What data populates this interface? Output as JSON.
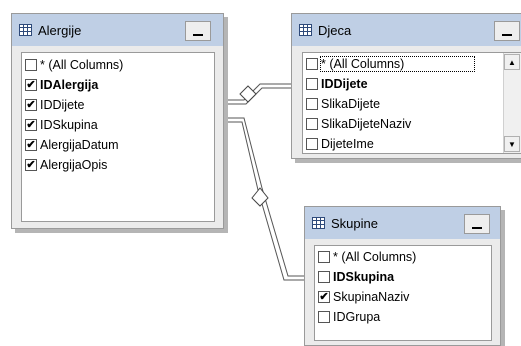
{
  "tables": {
    "alergije": {
      "title": "Alergije",
      "columns": [
        {
          "label": "* (All Columns)",
          "checked": false,
          "bold": false
        },
        {
          "label": "IDAlergija",
          "checked": true,
          "bold": true
        },
        {
          "label": "IDDijete",
          "checked": true,
          "bold": false
        },
        {
          "label": "IDSkupina",
          "checked": true,
          "bold": false
        },
        {
          "label": "AlergijaDatum",
          "checked": true,
          "bold": false
        },
        {
          "label": "AlergijaOpis",
          "checked": true,
          "bold": false
        }
      ]
    },
    "djeca": {
      "title": "Djeca",
      "columns": [
        {
          "label": "* (All Columns)",
          "checked": false,
          "bold": false
        },
        {
          "label": "IDDijete",
          "checked": false,
          "bold": true
        },
        {
          "label": "SlikaDijete",
          "checked": false,
          "bold": false
        },
        {
          "label": "SlikaDijeteNaziv",
          "checked": false,
          "bold": false
        },
        {
          "label": "DijeteIme",
          "checked": false,
          "bold": false
        }
      ]
    },
    "skupine": {
      "title": "Skupine",
      "columns": [
        {
          "label": "* (All Columns)",
          "checked": false,
          "bold": false
        },
        {
          "label": "IDSkupina",
          "checked": false,
          "bold": true
        },
        {
          "label": "SkupinaNaziv",
          "checked": true,
          "bold": false
        },
        {
          "label": "IDGrupa",
          "checked": false,
          "bold": false
        }
      ]
    }
  },
  "icons": {
    "table": "table-icon",
    "minimize": "minimize-icon",
    "scroll_up": "scroll-up-arrow-icon",
    "scroll_down": "scroll-down-arrow-icon",
    "relationship": "relationship-key-icon"
  },
  "colors": {
    "titlebar": "#bfcfe5",
    "window_bg": "#ebebeb",
    "list_bg": "#ffffff",
    "border": "#9a9a9a"
  }
}
